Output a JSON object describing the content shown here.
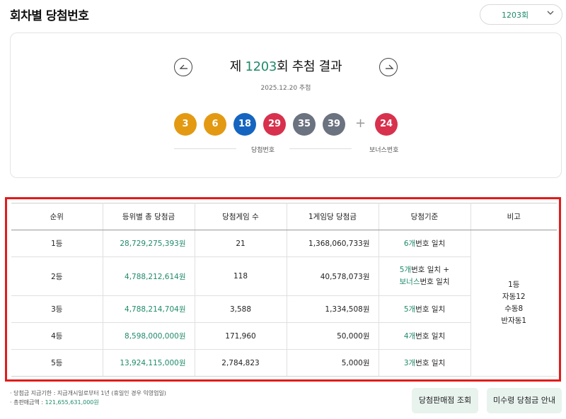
{
  "page": {
    "title": "회차별 당첨번호"
  },
  "round_select": {
    "value": "1203회"
  },
  "draw": {
    "title_prefix": "제 ",
    "round": "1203",
    "title_suffix": "회 추첨 결과",
    "date": "2025.12.20 추첨",
    "numbers": [
      "3",
      "6",
      "18",
      "29",
      "35",
      "39"
    ],
    "number_colors": [
      "#e39a12",
      "#e39a12",
      "#1565c0",
      "#d8314d",
      "#6b7280",
      "#6b7280"
    ],
    "plus": "+",
    "bonus": "24",
    "bonus_color": "#d8314d",
    "main_label": "당첨번호",
    "bonus_label": "보너스번호"
  },
  "table": {
    "headers": [
      "순위",
      "등위별 총 당첨금",
      "당첨게임 수",
      "1게임당 당첨금",
      "당첨기준",
      "비고"
    ],
    "rows": [
      {
        "rank": "1등",
        "total": "28,729,275,393원",
        "games": "21",
        "per_game": "1,368,060,733원",
        "crit_a": "6개",
        "crit_b": "번호 일치"
      },
      {
        "rank": "2등",
        "total": "4,788,212,614원",
        "games": "118",
        "per_game": "40,578,073원",
        "crit_a": "5개",
        "crit_b": "번호 일치 +",
        "crit_c": "보너스",
        "crit_d": "번호 일치"
      },
      {
        "rank": "3등",
        "total": "4,788,214,704원",
        "games": "3,588",
        "per_game": "1,334,508원",
        "crit_a": "5개",
        "crit_b": "번호 일치"
      },
      {
        "rank": "4등",
        "total": "8,598,000,000원",
        "games": "171,960",
        "per_game": "50,000원",
        "crit_a": "4개",
        "crit_b": "번호 일치"
      },
      {
        "rank": "5등",
        "total": "13,924,115,000원",
        "games": "2,784,823",
        "per_game": "5,000원",
        "crit_a": "3개",
        "crit_b": "번호 일치"
      }
    ],
    "note_lines": [
      "1등",
      "자동12",
      "수동8",
      "반자동1"
    ]
  },
  "footer": {
    "deadline_text": "· 당첨금 지급기한 : 지급개시일로부터 1년 (휴일인 경우 익영업일)",
    "sales_label": "· 총판매금액 : ",
    "sales_value": "121,655,631,000원",
    "store_button": "당첨판매점 조회",
    "unclaimed_button": "미수령 당첨금 안내"
  },
  "colors": {
    "accent": "#1f8a6b",
    "highlight_border": "#e21b1b",
    "button_bg": "#e8f3ee"
  },
  "icons": {
    "dropdown": "chevron-down-icon",
    "prev": "arrow-left-icon",
    "next": "arrow-right-icon"
  }
}
